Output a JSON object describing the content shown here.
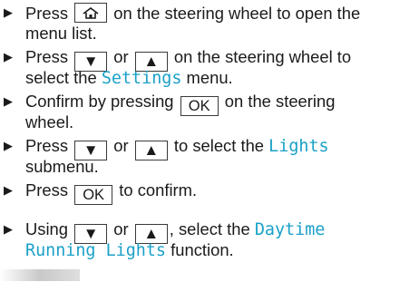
{
  "steps": [
    {
      "pre": "Press",
      "post": "on the steering wheel to open the",
      "line2": "menu list."
    },
    {
      "pre": "Press",
      "mid": "or",
      "post": "on the steering wheel to",
      "line2_pre": "select the",
      "line2_term": "Settings",
      "line2_post": "menu."
    },
    {
      "pre": "Confirm by pressing",
      "post": "on the steering",
      "line2": "wheel."
    },
    {
      "pre": "Press",
      "mid": "or",
      "post": "to select the",
      "term": "Lights",
      "line2": "submenu."
    },
    {
      "pre": "Press",
      "post": "to confirm."
    },
    {
      "pre": "Using",
      "mid": "or",
      "post": ", select the",
      "term": "Daytime",
      "line2_term": "Running Lights",
      "line2_post": "function."
    }
  ],
  "keys": {
    "home": "home-icon",
    "down": "▼",
    "up": "▲",
    "ok": "OK"
  },
  "colors": {
    "display_text": "#1aa0c8",
    "text": "#1a1a1a",
    "key_border": "#3a3a3a"
  }
}
